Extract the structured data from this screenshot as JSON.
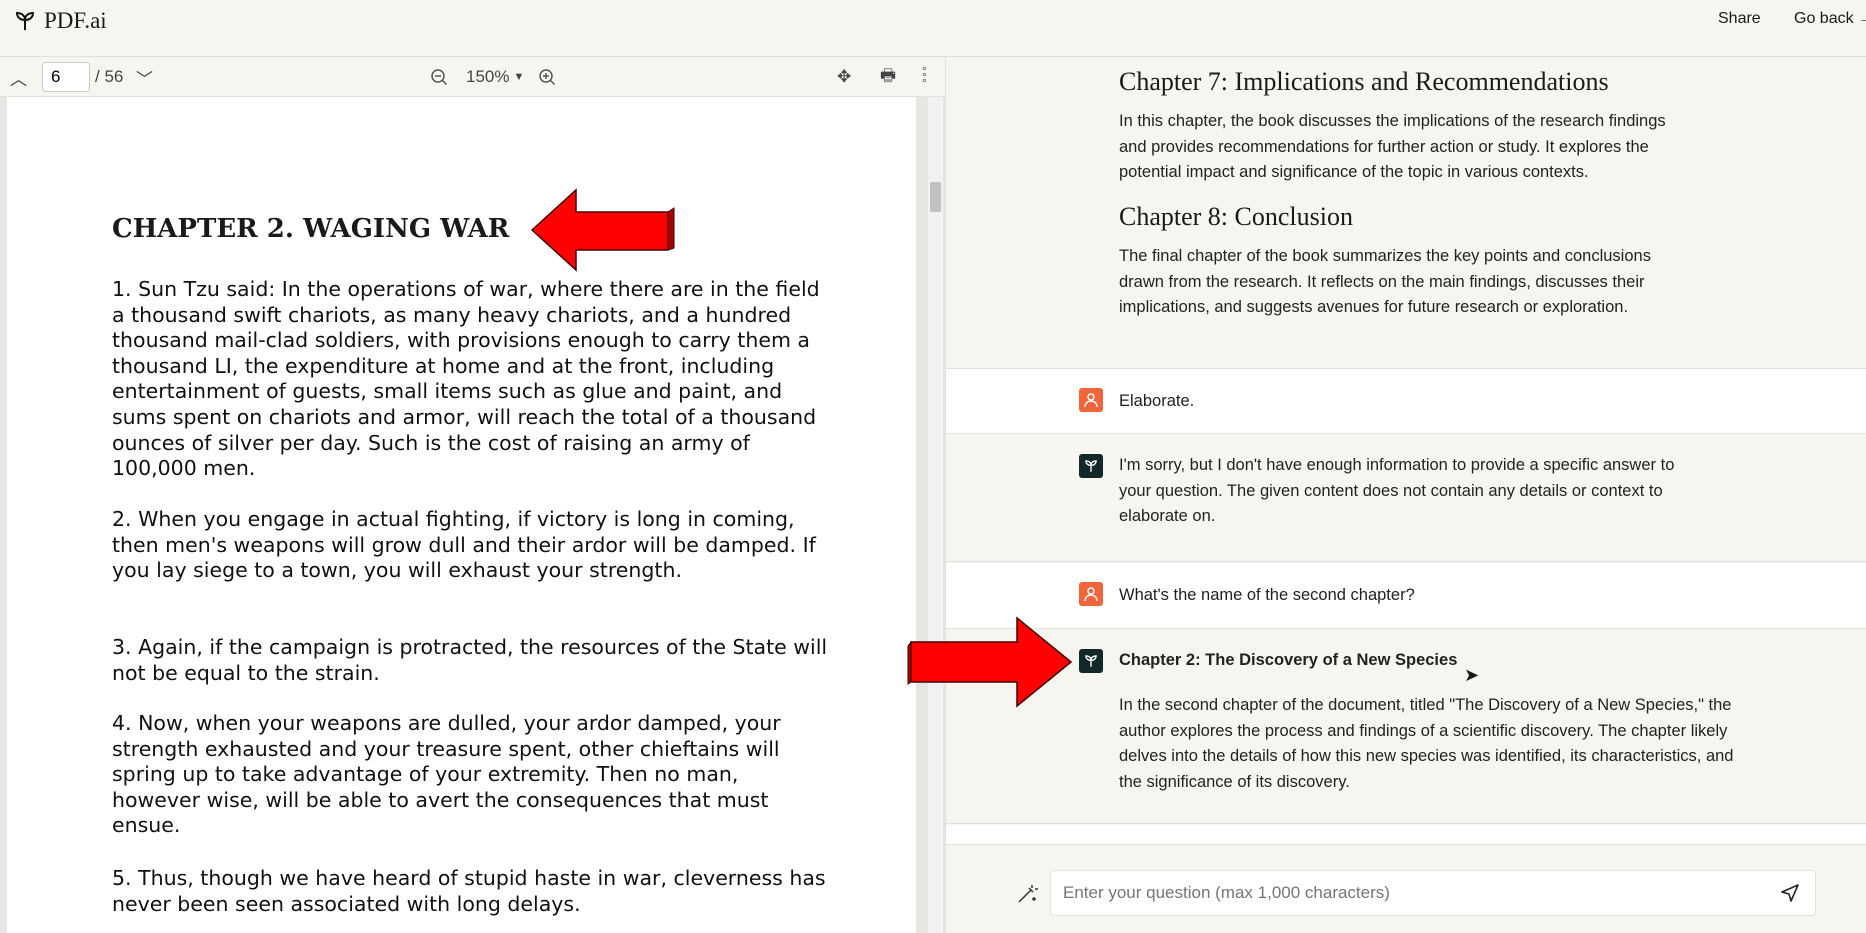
{
  "app": {
    "title": "PDF.ai",
    "share": "Share",
    "go_back": "Go back →"
  },
  "toolbar": {
    "page": "6",
    "total": "/ 56",
    "zoom": "150%"
  },
  "pdf": {
    "chapter_title": "CHAPTER 2. WAGING WAR",
    "paragraphs": [
      "1.  Sun Tzu said: In the operations of war, where there are in the field a thousand swift chariots, as many heavy chariots, and a hundred thousand mail-clad soldiers, with provisions enough to carry them a thousand LI, the expenditure at home and at the front, including entertainment of guests, small items such as glue and paint, and sums spent on chariots and armor, will reach the total of a thousand ounces of silver per day. Such is the cost of raising an army of 100,000 men.",
      "2. When you engage in actual fighting, if victory is long in coming, then men's weapons will grow dull and their ardor will be damped. If you lay siege to a town, you will exhaust your strength.",
      "3. Again, if the campaign is protracted, the resources of the State will not be equal to the strain.",
      "4. Now, when your weapons are dulled, your ardor damped, your strength exhausted and your treasure spent, other chieftains will spring up to take advantage of your extremity. Then no man, however wise, will be able to avert the consequences that must ensue.",
      "5. Thus, though we have heard of stupid haste in war, cleverness has never been seen associated with long delays."
    ]
  },
  "chat": {
    "summary": [
      {
        "heading": "Chapter 7: Implications and Recommendations",
        "text": "In this chapter, the book discusses the implications of the research findings and provides recommendations for further action or study. It explores the potential impact and significance of the topic in various contexts."
      },
      {
        "heading": "Chapter 8: Conclusion",
        "text": "The final chapter of the book summarizes the key points and conclusions drawn from the research. It reflects on the main findings, discusses their implications, and suggests avenues for future research or exploration."
      }
    ],
    "messages": [
      {
        "role": "user",
        "text": "Elaborate."
      },
      {
        "role": "bot",
        "text": "I'm sorry, but I don't have enough information to provide a specific answer to your question. The given content does not contain any details or context to elaborate on."
      },
      {
        "role": "user",
        "text": "What's the name of the second chapter?"
      },
      {
        "role": "bot",
        "title": "Chapter 2: The Discovery of a New Species",
        "text": "In the second chapter of the document, titled \"The Discovery of a New Species,\" the author explores the process and findings of a scientific discovery. The chapter likely delves into the details of how this new species was identified, its characteristics, and the significance of its discovery."
      }
    ],
    "input_placeholder": "Enter your question (max 1,000 characters)"
  },
  "colors": {
    "user_avatar": "#f2653a",
    "bot_avatar": "#12282a",
    "arrow": "#ff0000"
  }
}
